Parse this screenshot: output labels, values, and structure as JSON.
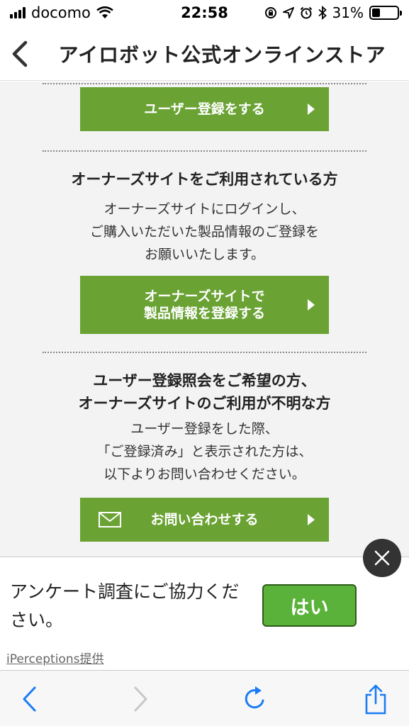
{
  "status_bar": {
    "carrier": "docomo",
    "time": "22:58",
    "battery": "31%",
    "battery_level": 0.31
  },
  "nav": {
    "title": "アイロボット公式オンラインストア",
    "back_icon": "chevron-left-icon"
  },
  "content": {
    "register_button": "ユーザー登録をする",
    "owners_section": {
      "title": "オーナーズサイトをご利用されている方",
      "body": [
        "オーナーズサイトにログインし、",
        "ご購入いただいた製品情報のご登録を",
        "お願いいたします。"
      ],
      "button_line1": "オーナーズサイトで",
      "button_line2": "製品情報を登録する"
    },
    "inquiry_section": {
      "title_line1": "ユーザー登録照会をご希望の方、",
      "title_line2": "オーナーズサイトのご利用が不明な方",
      "body": [
        "ユーザー登録をした際、",
        "「ご登録済み」と表示された方は、",
        "以下よりお問い合わせください。"
      ],
      "button": "お問い合わせする",
      "button_icon": "mail-icon"
    }
  },
  "survey": {
    "text_line1": "アンケート調査にご協力くだ",
    "text_line2": "さい。",
    "yes_button": "はい",
    "provider": "iPerceptions提供",
    "close_icon": "close-icon"
  },
  "colors": {
    "button_green": "#6aa233",
    "yes_green": "#5bb23a",
    "ios_blue": "#1a7cf5",
    "content_bg": "#f3f3f3"
  },
  "toolbar": {
    "icons": [
      "back-icon",
      "forward-icon",
      "reload-icon",
      "share-icon"
    ]
  }
}
